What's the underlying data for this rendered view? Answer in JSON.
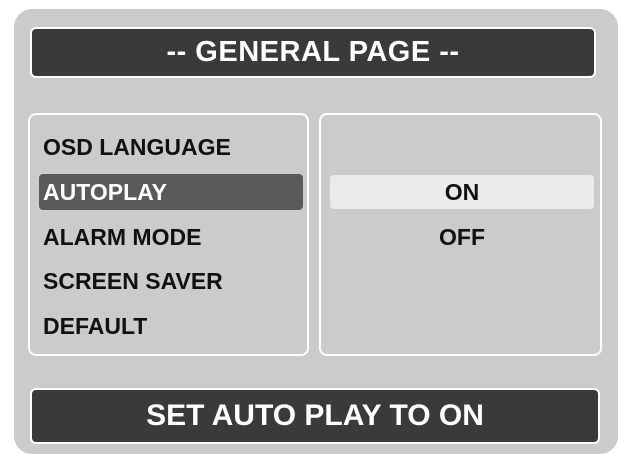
{
  "header": {
    "title": "-- GENERAL PAGE --"
  },
  "menu": {
    "selected_index": 1,
    "items": [
      {
        "label": "OSD LANGUAGE"
      },
      {
        "label": "AUTOPLAY"
      },
      {
        "label": "ALARM MODE"
      },
      {
        "label": "SCREEN SAVER"
      },
      {
        "label": "DEFAULT"
      }
    ]
  },
  "options": {
    "selected_index": 0,
    "items": [
      {
        "label": "ON"
      },
      {
        "label": "OFF"
      }
    ]
  },
  "status": {
    "message": "SET AUTO PLAY TO ON"
  },
  "colors": {
    "panel_background": "#cbcbcb",
    "bar_background": "#3a3a3a",
    "menu_highlight": "#5a5a5a",
    "option_highlight": "#ebebeb",
    "border": "#ffffff"
  }
}
